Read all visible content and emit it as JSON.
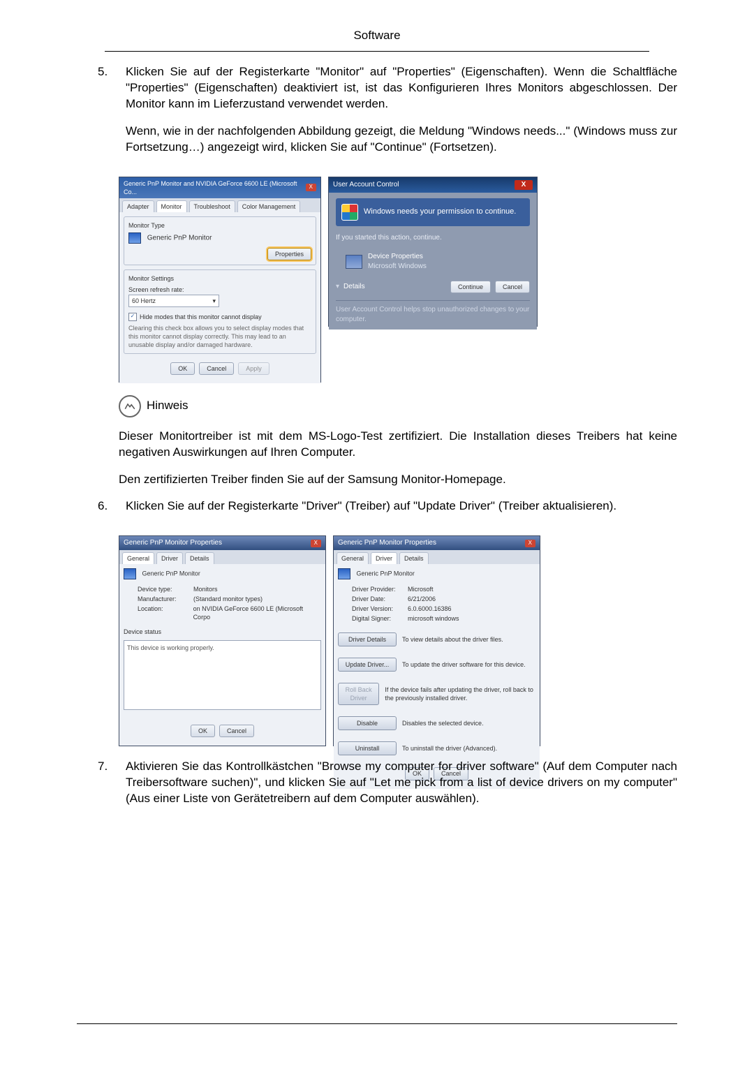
{
  "header": {
    "section": "Software"
  },
  "step5": {
    "num": "5.",
    "p1": "Klicken Sie auf der Registerkarte \"Monitor\" auf \"Properties\" (Eigenschaften). Wenn die Schaltfläche \"Properties\" (Eigenschaften) deaktiviert ist, ist das Konfigurieren Ihres Monitors abgeschlossen. Der Monitor kann im Lieferzustand verwendet werden.",
    "p2": "Wenn, wie in der nachfolgenden Abbildung gezeigt, die Meldung \"Windows needs...\" (Windows muss zur Fortsetzung…) angezeigt wird, klicken Sie auf \"Continue\" (Fortsetzen)."
  },
  "monitorDialog": {
    "title": "Generic PnP Monitor and NVIDIA GeForce 6600 LE (Microsoft Co...",
    "tabs": {
      "adapter": "Adapter",
      "monitor": "Monitor",
      "troubleshoot": "Troubleshoot",
      "color": "Color Management"
    },
    "monType": "Monitor Type",
    "monName": "Generic PnP Monitor",
    "propBtn": "Properties",
    "settings": "Monitor Settings",
    "refresh": "Screen refresh rate:",
    "hz": "60 Hertz",
    "hideChk": "Hide modes that this monitor cannot display",
    "hideDesc": "Clearing this check box allows you to select display modes that this monitor cannot display correctly. This may lead to an unusable display and/or damaged hardware.",
    "ok": "OK",
    "cancel": "Cancel",
    "apply": "Apply"
  },
  "uac": {
    "title": "User Account Control",
    "headline": "Windows needs your permission to continue.",
    "started": "If you started this action, continue.",
    "devProp": "Device Properties",
    "msWin": "Microsoft Windows",
    "details": "Details",
    "continue": "Continue",
    "cancel": "Cancel",
    "footer": "User Account Control helps stop unauthorized changes to your computer."
  },
  "hinweis": {
    "label": "Hinweis",
    "p1": "Dieser Monitortreiber ist mit dem MS-Logo-Test zertifiziert. Die Installation dieses Treibers hat keine negativen Auswirkungen auf Ihren Computer.",
    "p2": "Den zertifizierten Treiber finden Sie auf der Samsung Monitor-Homepage."
  },
  "step6": {
    "num": "6.",
    "p1": "Klicken Sie auf der Registerkarte \"Driver\" (Treiber) auf \"Update Driver\" (Treiber aktualisieren)."
  },
  "propGeneral": {
    "title": "Generic PnP Monitor Properties",
    "tabs": {
      "general": "General",
      "driver": "Driver",
      "details": "Details"
    },
    "monName": "Generic PnP Monitor",
    "devtypeK": "Device type:",
    "devtypeV": "Monitors",
    "mfrK": "Manufacturer:",
    "mfrV": "(Standard monitor types)",
    "locK": "Location:",
    "locV": "on NVIDIA GeForce 6600 LE (Microsoft Corpo",
    "status": "Device status",
    "statusText": "This device is working properly.",
    "ok": "OK",
    "cancel": "Cancel"
  },
  "propDriver": {
    "title": "Generic PnP Monitor Properties",
    "tabs": {
      "general": "General",
      "driver": "Driver",
      "details": "Details"
    },
    "monName": "Generic PnP Monitor",
    "provK": "Driver Provider:",
    "provV": "Microsoft",
    "dateK": "Driver Date:",
    "dateV": "6/21/2006",
    "verK": "Driver Version:",
    "verV": "6.0.6000.16386",
    "signK": "Digital Signer:",
    "signV": "microsoft windows",
    "btnDetails": "Driver Details",
    "descDetails": "To view details about the driver files.",
    "btnUpdate": "Update Driver...",
    "descUpdate": "To update the driver software for this device.",
    "btnRoll": "Roll Back Driver",
    "descRoll": "If the device fails after updating the driver, roll back to the previously installed driver.",
    "btnDisable": "Disable",
    "descDisable": "Disables the selected device.",
    "btnUninstall": "Uninstall",
    "descUninstall": "To uninstall the driver (Advanced).",
    "ok": "OK",
    "cancel": "Cancel"
  },
  "step7": {
    "num": "7.",
    "p1": "Aktivieren Sie das Kontrollkästchen \"Browse my computer for driver software\" (Auf dem Computer nach Treibersoftware suchen)\", und klicken Sie auf \"Let me pick from a list of device drivers on my computer\" (Aus einer Liste von Gerätetreibern auf dem Computer auswählen)."
  }
}
